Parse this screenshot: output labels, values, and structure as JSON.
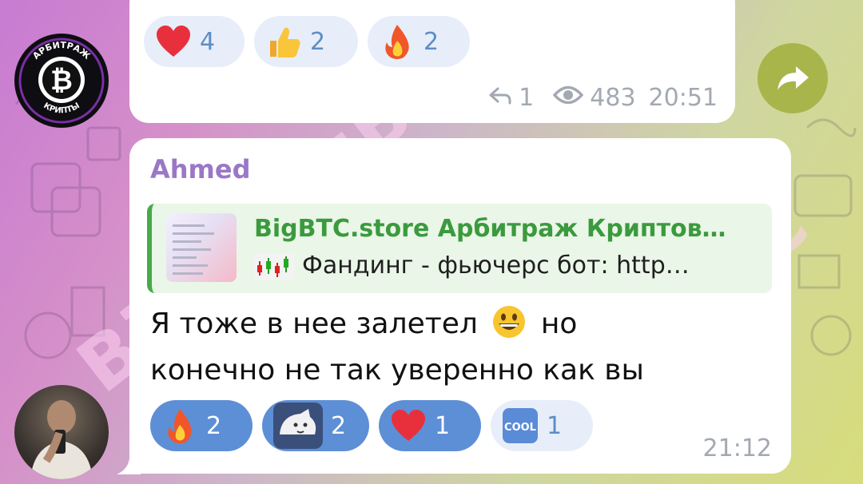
{
  "channel_avatar": {
    "ring_top": "АРБИТРАЖ",
    "ring_bottom": "КРИПТЫ"
  },
  "post": {
    "reactions": [
      {
        "emoji": "heart",
        "count": "4"
      },
      {
        "emoji": "thumbs-up",
        "count": "2"
      },
      {
        "emoji": "fire",
        "count": "2"
      }
    ],
    "replies": "1",
    "views": "483",
    "time": "20:51"
  },
  "comment": {
    "sender": "Ahmed",
    "reply": {
      "title": "BigBTC.store Арбитраж Криптов…",
      "text": "Фандинг - фьючерс бот: http…"
    },
    "text_line1": "Я тоже в нее залетел",
    "text_line1_end": "но",
    "text_line2": "конечно не так уверенно как вы",
    "reactions": [
      {
        "emoji": "fire",
        "count": "2",
        "active": true
      },
      {
        "emoji": "sticker",
        "count": "2",
        "active": true
      },
      {
        "emoji": "heart",
        "count": "1",
        "active": true
      },
      {
        "emoji": "cool",
        "label": "COOL",
        "count": "1",
        "active": false
      }
    ],
    "time": "21:12"
  },
  "watermark": "BigBTC",
  "colors": {
    "sender": "#9a78c6",
    "reply_accent": "#46a94a",
    "reaction_active": "#5d8fd6",
    "reaction_inactive": "#e7eef9",
    "share_button": "#a7b54a"
  }
}
